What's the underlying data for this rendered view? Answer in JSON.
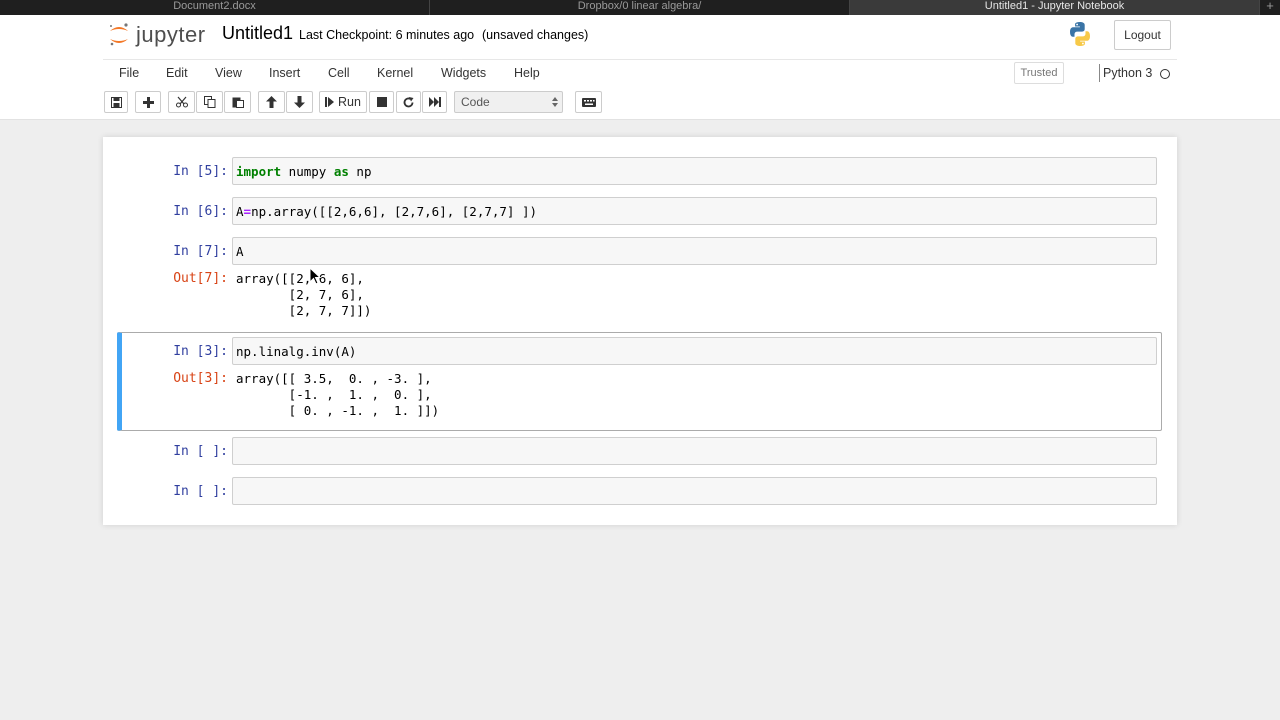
{
  "browser_tabs": [
    "Document2.docx",
    "Dropbox/0 linear algebra/",
    "Untitled1 - Jupyter Notebook",
    "+"
  ],
  "header": {
    "logo_text": "jupyter",
    "notebook_title": "Untitled1",
    "checkpoint": "Last Checkpoint: 6 minutes ago",
    "unsaved": "(unsaved changes)",
    "logout_label": "Logout"
  },
  "menu": {
    "items": [
      "File",
      "Edit",
      "View",
      "Insert",
      "Cell",
      "Kernel",
      "Widgets",
      "Help"
    ],
    "trusted": "Trusted",
    "kernel_name": "Python 3"
  },
  "toolbar": {
    "run_label": "Run",
    "cell_type": "Code"
  },
  "cells": [
    {
      "prompt": "In [5]:",
      "code_kw": "import",
      "code_rest": " numpy ",
      "code_kw2": "as",
      "code_rest2": " np"
    },
    {
      "prompt": "In [6]:",
      "code_a": "A",
      "code_op": "=",
      "code_b": "np.array([[2,6,6], [2,7,6], [2,7,7] ])"
    },
    {
      "prompt": "In [7]:",
      "code": "A",
      "out_prompt": "Out[7]:",
      "output": "array([[2, 6, 6],\n       [2, 7, 6],\n       [2, 7, 7]])"
    },
    {
      "prompt": "In [3]:",
      "code": "np.linalg.inv(A)",
      "out_prompt": "Out[3]:",
      "output": "array([[ 3.5,  0. , -3. ],\n       [-1. ,  1. ,  0. ],\n       [ 0. , -1. ,  1. ]])"
    },
    {
      "prompt": "In [ ]:",
      "code": ""
    },
    {
      "prompt": "In [ ]:",
      "code": ""
    }
  ],
  "colors": {
    "in_prompt": "#303f9f",
    "out_prompt": "#d84315",
    "selected_border": "#42a5f5",
    "keyword": "#008000"
  }
}
